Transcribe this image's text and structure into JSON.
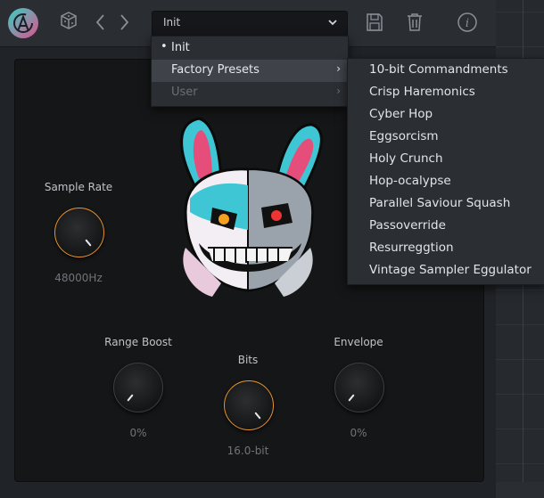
{
  "colors": {
    "accent": "#e8932d",
    "panel": "#151617",
    "menu_bg": "#2b2e33",
    "menu_highlight": "#3e4349"
  },
  "toolbar": {
    "logo_icon": "plugin-logo-icon",
    "preset_name": "Init",
    "icons": [
      "dice-icon",
      "prev-arrow-icon",
      "next-arrow-icon",
      "save-icon",
      "trash-icon",
      "info-icon"
    ]
  },
  "preset_menu": {
    "items": [
      {
        "label": "Init",
        "selected": true,
        "has_submenu": false,
        "enabled": true
      },
      {
        "label": "Factory Presets",
        "selected": false,
        "has_submenu": true,
        "enabled": true,
        "highlighted": true
      },
      {
        "label": "User",
        "selected": false,
        "has_submenu": true,
        "enabled": false
      }
    ],
    "bullet": "•",
    "arrow": "›"
  },
  "factory_submenu": {
    "items": [
      "10-bit Commandments",
      "Crisp Haremonics",
      "Cyber Hop",
      "Eggsorcism",
      "Holy Crunch",
      "Hop-ocalypse",
      "Parallel Saviour Squash",
      "Passoverride",
      "Resurreggtion",
      "Vintage Sampler Eggulator"
    ]
  },
  "controls": {
    "sample_rate": {
      "label": "Sample Rate",
      "value": "48000Hz",
      "level": 0.85
    },
    "range_boost": {
      "label": "Range Boost",
      "value": "0%",
      "level": 0.0
    },
    "bits": {
      "label": "Bits",
      "value": "16.0-bit",
      "level": 0.85
    },
    "envelope": {
      "label": "Envelope",
      "value": "0%",
      "level": 0.0
    }
  },
  "artwork": "bunny-mascot-illustration"
}
